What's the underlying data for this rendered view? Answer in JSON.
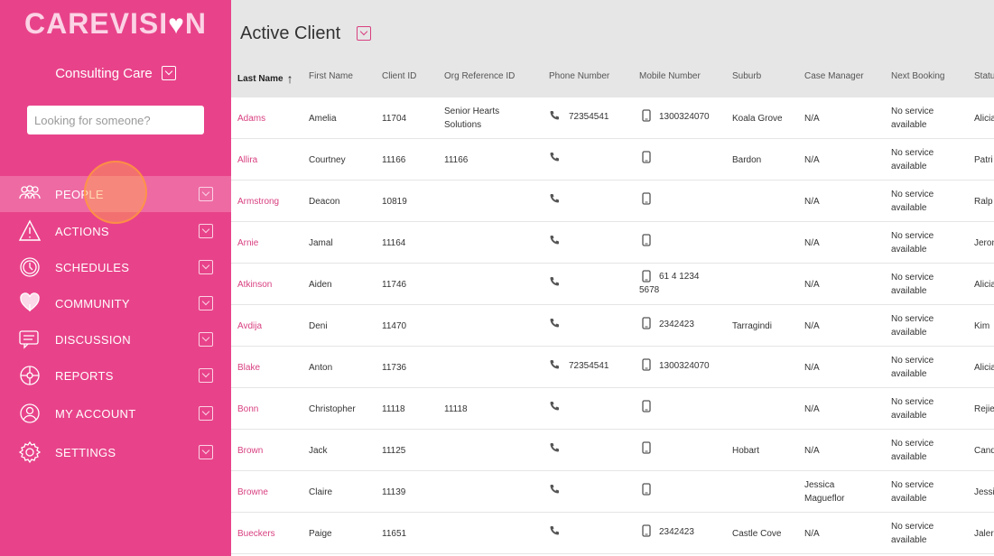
{
  "brand": {
    "logo_text": "CAREVISI",
    "logo_end": "N"
  },
  "org": {
    "name": "Consulting Care"
  },
  "search": {
    "placeholder": "Looking for someone?"
  },
  "nav": [
    {
      "label": "PEOPLE",
      "icon": "people-icon",
      "active": true
    },
    {
      "label": "ACTIONS",
      "icon": "warning-icon"
    },
    {
      "label": "SCHEDULES",
      "icon": "clock-icon"
    },
    {
      "label": "COMMUNITY",
      "icon": "heart-hands-icon"
    },
    {
      "label": "DISCUSSION",
      "icon": "chat-icon"
    },
    {
      "label": "REPORTS",
      "icon": "reports-icon"
    },
    {
      "label": "MY ACCOUNT",
      "icon": "user-icon"
    },
    {
      "label": "SETTINGS",
      "icon": "gear-icon"
    }
  ],
  "page": {
    "title": "Active Client"
  },
  "columns": [
    "Last Name",
    "First Name",
    "Client ID",
    "Org Reference ID",
    "Phone Number",
    "Mobile Number",
    "Suburb",
    "Case Manager",
    "Next Booking",
    "Statu"
  ],
  "rows": [
    {
      "last": "Adams",
      "first": "Amelia",
      "id": "11704",
      "org_ref": "Senior Hearts Solutions",
      "phone": "72354541",
      "mobile": "1300324070",
      "suburb": "Koala Grove",
      "manager": "N/A",
      "booking": "No service available",
      "status": "Alicia"
    },
    {
      "last": "Allira",
      "first": "Courtney",
      "id": "11166",
      "org_ref": "11166",
      "phone": "",
      "mobile": "",
      "suburb": "Bardon",
      "manager": "N/A",
      "booking": "No service available",
      "status": "Patri"
    },
    {
      "last": "Armstrong",
      "first": "Deacon",
      "id": "10819",
      "org_ref": "",
      "phone": "",
      "mobile": "",
      "suburb": "",
      "manager": "N/A",
      "booking": "No service available",
      "status": "Ralp"
    },
    {
      "last": "Arnie",
      "first": "Jamal",
      "id": "11164",
      "org_ref": "",
      "phone": "",
      "mobile": "",
      "suburb": "",
      "manager": "N/A",
      "booking": "No service available",
      "status": "Jeron"
    },
    {
      "last": "Atkinson",
      "first": "Aiden",
      "id": "11746",
      "org_ref": "",
      "phone": "",
      "mobile": "61 4 1234 5678",
      "suburb": "",
      "manager": "N/A",
      "booking": "No service available",
      "status": "Alicia"
    },
    {
      "last": "Avdija",
      "first": "Deni",
      "id": "11470",
      "org_ref": "",
      "phone": "",
      "mobile": "2342423",
      "suburb": "Tarragindi",
      "manager": "N/A",
      "booking": "No service available",
      "status": "Kim"
    },
    {
      "last": "Blake",
      "first": "Anton",
      "id": "11736",
      "org_ref": "",
      "phone": "72354541",
      "mobile": "1300324070",
      "suburb": "",
      "manager": "N/A",
      "booking": "No service available",
      "status": "Alicia"
    },
    {
      "last": "Bonn",
      "first": "Christopher",
      "id": "11118",
      "org_ref": "11118",
      "phone": "",
      "mobile": "",
      "suburb": "",
      "manager": "N/A",
      "booking": "No service available",
      "status": "Rejie"
    },
    {
      "last": "Brown",
      "first": "Jack",
      "id": "11125",
      "org_ref": "",
      "phone": "",
      "mobile": "",
      "suburb": "Hobart",
      "manager": "N/A",
      "booking": "No service available",
      "status": "Cand"
    },
    {
      "last": "Browne",
      "first": "Claire",
      "id": "11139",
      "org_ref": "",
      "phone": "",
      "mobile": "",
      "suburb": "",
      "manager": "Jessica Magueflor",
      "booking": "No service available",
      "status": "Jessi"
    },
    {
      "last": "Bueckers",
      "first": "Paige",
      "id": "11651",
      "org_ref": "",
      "phone": "",
      "mobile": "2342423",
      "suburb": "Castle Cove",
      "manager": "N/A",
      "booking": "No service available",
      "status": "Jaler"
    }
  ],
  "colors": {
    "sidebar": "#e8438a",
    "active_nav": "#ee6aa3",
    "accent": "#d84080",
    "header_bg": "#e6e6e6"
  }
}
